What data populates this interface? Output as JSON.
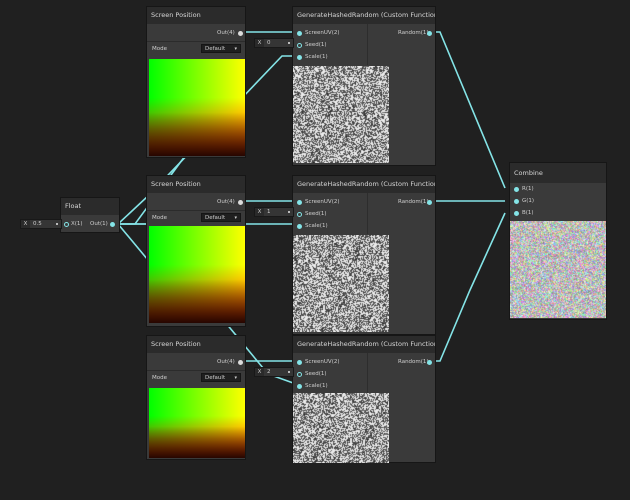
{
  "screen_position_nodes": [
    {
      "title": "Screen Position",
      "out_label": "Out(4)",
      "mode_label": "Mode",
      "mode_value": "Default"
    },
    {
      "title": "Screen Position",
      "out_label": "Out(4)",
      "mode_label": "Mode",
      "mode_value": "Default"
    },
    {
      "title": "Screen Position",
      "out_label": "Out(4)",
      "mode_label": "Mode",
      "mode_value": "Default"
    }
  ],
  "hash_nodes": [
    {
      "title": "GenerateHashedRandom (Custom Function)",
      "in1": "ScreenUV(2)",
      "in2": "Seed(1)",
      "in3": "Scale(1)",
      "out": "Random(1)",
      "seed_axis": "X",
      "seed_value": "0"
    },
    {
      "title": "GenerateHashedRandom (Custom Function)",
      "in1": "ScreenUV(2)",
      "in2": "Seed(1)",
      "in3": "Scale(1)",
      "out": "Random(1)",
      "seed_axis": "X",
      "seed_value": "1"
    },
    {
      "title": "GenerateHashedRandom (Custom Function)",
      "in1": "ScreenUV(2)",
      "in2": "Seed(1)",
      "in3": "Scale(1)",
      "out": "Random(1)",
      "seed_axis": "X",
      "seed_value": "2"
    }
  ],
  "float_node": {
    "title": "Float",
    "in": "X(1)",
    "out": "Out(1)",
    "axis": "X",
    "value": "0.5"
  },
  "combine_node": {
    "title": "Combine",
    "r": "R(1)",
    "g": "G(1)",
    "b": "B(1)"
  },
  "colors": {
    "wire": "#84e4e7",
    "background": "#202020",
    "node_body": "#3a3a3a",
    "node_header": "#2b2b2b"
  }
}
